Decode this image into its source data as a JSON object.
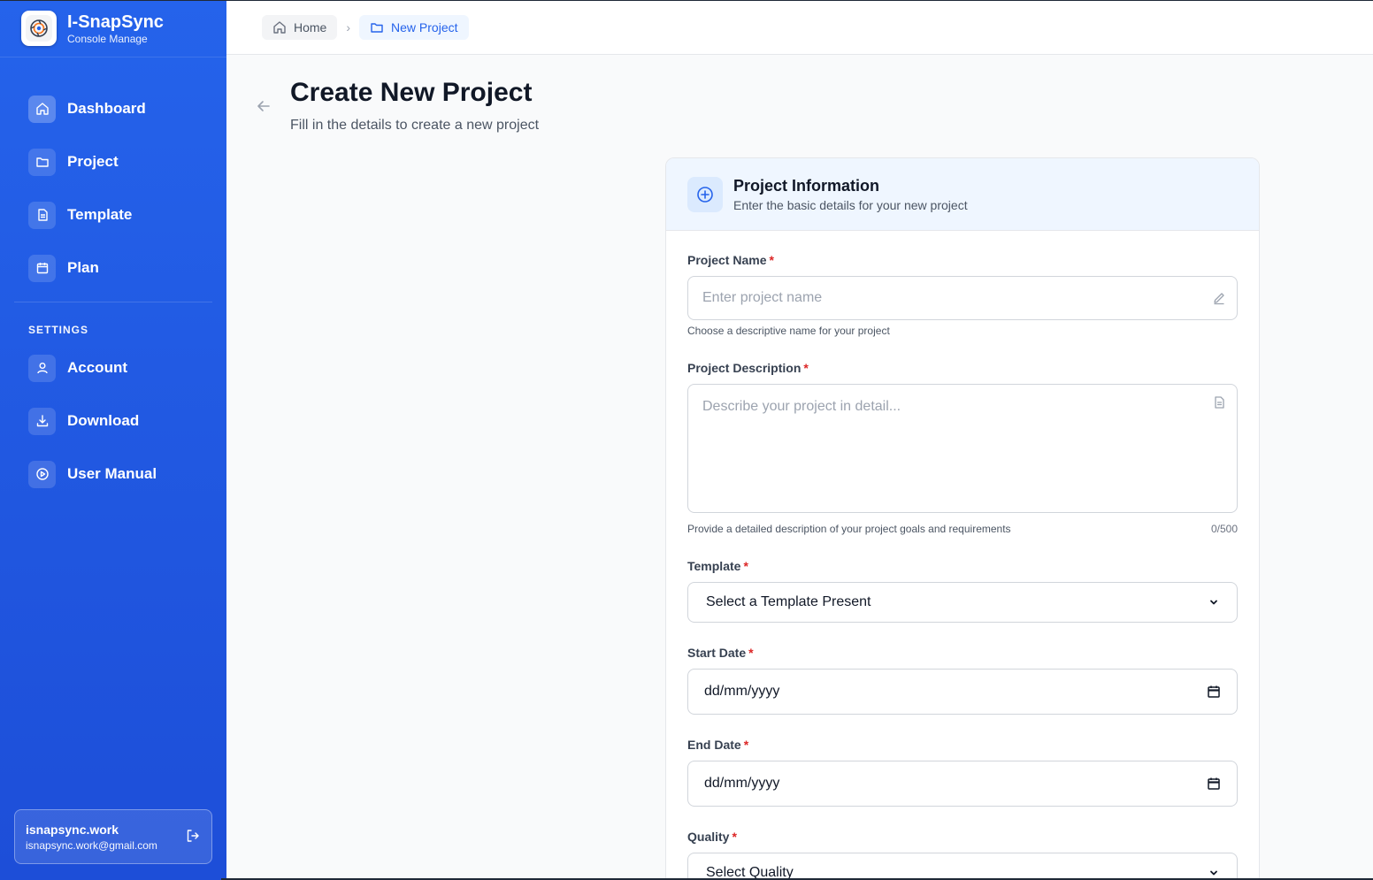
{
  "brand": {
    "title": "I-SnapSync",
    "subtitle": "Console Manage"
  },
  "sidebar": {
    "items": [
      {
        "label": "Dashboard"
      },
      {
        "label": "Project"
      },
      {
        "label": "Template"
      },
      {
        "label": "Plan"
      }
    ],
    "settings_title": "SETTINGS",
    "settings_items": [
      {
        "label": "Account"
      },
      {
        "label": "Download"
      },
      {
        "label": "User Manual"
      }
    ],
    "user": {
      "name": "isnapsync.work",
      "email": "isnapsync.work@gmail.com"
    }
  },
  "breadcrumb": {
    "home": "Home",
    "separator": "›",
    "current": "New Project"
  },
  "header": {
    "title": "Create New Project",
    "subtitle": "Fill in the details to create a new project"
  },
  "card": {
    "title": "Project Information",
    "subtitle": "Enter the basic details for your new project"
  },
  "form": {
    "project_name": {
      "label": "Project Name",
      "required": "*",
      "placeholder": "Enter project name",
      "helper": "Choose a descriptive name for your project"
    },
    "project_description": {
      "label": "Project Description",
      "required": "*",
      "placeholder": "Describe your project in detail...",
      "helper": "Provide a detailed description of your project goals and requirements",
      "counter": "0/500"
    },
    "template": {
      "label": "Template",
      "required": "*",
      "value": "Select a Template Present"
    },
    "start_date": {
      "label": "Start Date",
      "required": "*",
      "value": "dd/mm/yyyy"
    },
    "end_date": {
      "label": "End Date",
      "required": "*",
      "value": "dd/mm/yyyy"
    },
    "quality": {
      "label": "Quality",
      "required": "*",
      "value": "Select Quality"
    }
  },
  "colors": {
    "sidebar_top": "#2563eb",
    "sidebar_bottom": "#1d4ed8",
    "accent": "#2563eb",
    "required": "#dc2626"
  }
}
